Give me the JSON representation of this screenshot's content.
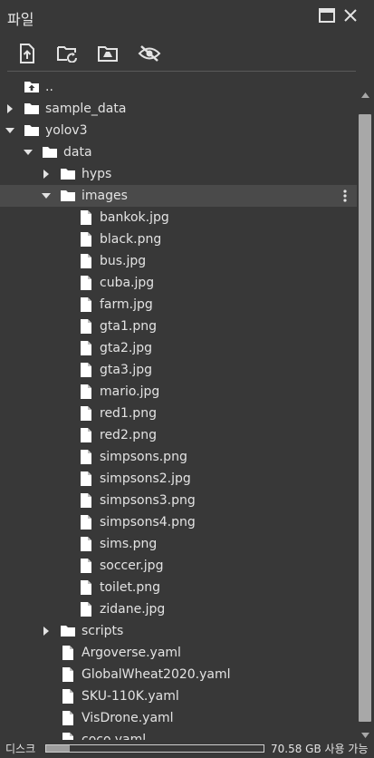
{
  "header": {
    "title": "파일"
  },
  "toolbar": {
    "buttons": [
      {
        "icon": "upload-file-icon"
      },
      {
        "icon": "refresh-folder-icon"
      },
      {
        "icon": "mount-drive-icon"
      },
      {
        "icon": "hide-eye-icon"
      }
    ]
  },
  "tree": {
    "rows": [
      {
        "label": "..",
        "type": "up",
        "depth": 0,
        "chevron": "none"
      },
      {
        "label": "sample_data",
        "type": "folder",
        "depth": 0,
        "chevron": "right"
      },
      {
        "label": "yolov3",
        "type": "folder",
        "depth": 0,
        "chevron": "down"
      },
      {
        "label": "data",
        "type": "folder",
        "depth": 1,
        "chevron": "down"
      },
      {
        "label": "hyps",
        "type": "folder",
        "depth": 2,
        "chevron": "right"
      },
      {
        "label": "images",
        "type": "folder",
        "depth": 2,
        "chevron": "down",
        "selected": true
      },
      {
        "label": "bankok.jpg",
        "type": "file",
        "depth": 3,
        "chevron": "none"
      },
      {
        "label": "black.png",
        "type": "file",
        "depth": 3,
        "chevron": "none"
      },
      {
        "label": "bus.jpg",
        "type": "file",
        "depth": 3,
        "chevron": "none"
      },
      {
        "label": "cuba.jpg",
        "type": "file",
        "depth": 3,
        "chevron": "none"
      },
      {
        "label": "farm.jpg",
        "type": "file",
        "depth": 3,
        "chevron": "none"
      },
      {
        "label": "gta1.png",
        "type": "file",
        "depth": 3,
        "chevron": "none"
      },
      {
        "label": "gta2.jpg",
        "type": "file",
        "depth": 3,
        "chevron": "none"
      },
      {
        "label": "gta3.jpg",
        "type": "file",
        "depth": 3,
        "chevron": "none"
      },
      {
        "label": "mario.jpg",
        "type": "file",
        "depth": 3,
        "chevron": "none"
      },
      {
        "label": "red1.png",
        "type": "file",
        "depth": 3,
        "chevron": "none"
      },
      {
        "label": "red2.png",
        "type": "file",
        "depth": 3,
        "chevron": "none"
      },
      {
        "label": "simpsons.png",
        "type": "file",
        "depth": 3,
        "chevron": "none"
      },
      {
        "label": "simpsons2.jpg",
        "type": "file",
        "depth": 3,
        "chevron": "none"
      },
      {
        "label": "simpsons3.png",
        "type": "file",
        "depth": 3,
        "chevron": "none"
      },
      {
        "label": "simpsons4.png",
        "type": "file",
        "depth": 3,
        "chevron": "none"
      },
      {
        "label": "sims.png",
        "type": "file",
        "depth": 3,
        "chevron": "none"
      },
      {
        "label": "soccer.jpg",
        "type": "file",
        "depth": 3,
        "chevron": "none"
      },
      {
        "label": "toilet.png",
        "type": "file",
        "depth": 3,
        "chevron": "none"
      },
      {
        "label": "zidane.jpg",
        "type": "file",
        "depth": 3,
        "chevron": "none"
      },
      {
        "label": "scripts",
        "type": "folder",
        "depth": 2,
        "chevron": "right"
      },
      {
        "label": "Argoverse.yaml",
        "type": "file",
        "depth": 2,
        "chevron": "none"
      },
      {
        "label": "GlobalWheat2020.yaml",
        "type": "file",
        "depth": 2,
        "chevron": "none"
      },
      {
        "label": "SKU-110K.yaml",
        "type": "file",
        "depth": 2,
        "chevron": "none"
      },
      {
        "label": "VisDrone.yaml",
        "type": "file",
        "depth": 2,
        "chevron": "none"
      },
      {
        "label": "coco.yaml",
        "type": "file",
        "depth": 2,
        "chevron": "none"
      }
    ]
  },
  "footer": {
    "disk_label": "디스크",
    "disk_usage_fraction": 0.11,
    "disk_text": "70.58 GB 사용 가능"
  }
}
